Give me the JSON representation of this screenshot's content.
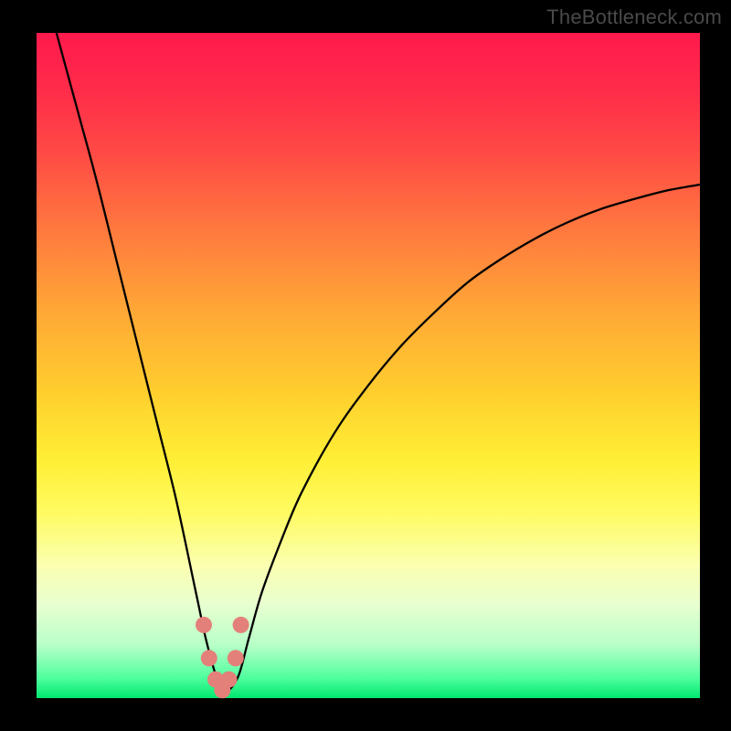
{
  "watermark": "TheBottleneck.com",
  "colors": {
    "frame": "#000000",
    "curve": "#000000",
    "marker": "#e4807a",
    "gradient_stops": [
      "#ff1a4d",
      "#ff2a4a",
      "#ff4a45",
      "#ff7a3e",
      "#ffa836",
      "#ffce2e",
      "#ffee35",
      "#fffb60",
      "#fbffb0",
      "#e8ffd0",
      "#b8ffc8",
      "#4fff9e",
      "#00e86e"
    ]
  },
  "chart_data": {
    "type": "line",
    "title": "",
    "xlabel": "",
    "ylabel": "",
    "xlim": [
      0,
      100
    ],
    "ylim": [
      0,
      100
    ],
    "grid": false,
    "legend": false,
    "description": "V-shaped bottleneck curve: steep left descent to near-zero around x≈28, then rising right branch.",
    "series": [
      {
        "name": "bottleneck",
        "x": [
          3,
          6,
          9,
          12,
          15,
          18,
          21,
          24,
          25.5,
          27,
          28,
          29,
          30.5,
          32,
          34,
          37,
          40,
          45,
          50,
          55,
          60,
          65,
          70,
          75,
          80,
          85,
          90,
          95,
          100
        ],
        "y": [
          100,
          89,
          78,
          66,
          54,
          42,
          30,
          16,
          9,
          3.5,
          1.2,
          1.2,
          3.5,
          9,
          16,
          24,
          31,
          40,
          47,
          53,
          58,
          62.5,
          66,
          69,
          71.5,
          73.5,
          75,
          76.3,
          77.2
        ]
      }
    ],
    "markers": {
      "series": "bottleneck",
      "points_x": [
        25.2,
        26.0,
        27.0,
        28.0,
        29.0,
        30.0,
        30.8
      ],
      "points_y": [
        11,
        6,
        2.8,
        1.2,
        2.8,
        6,
        11
      ],
      "color": "#e4807a",
      "size": 9
    }
  }
}
